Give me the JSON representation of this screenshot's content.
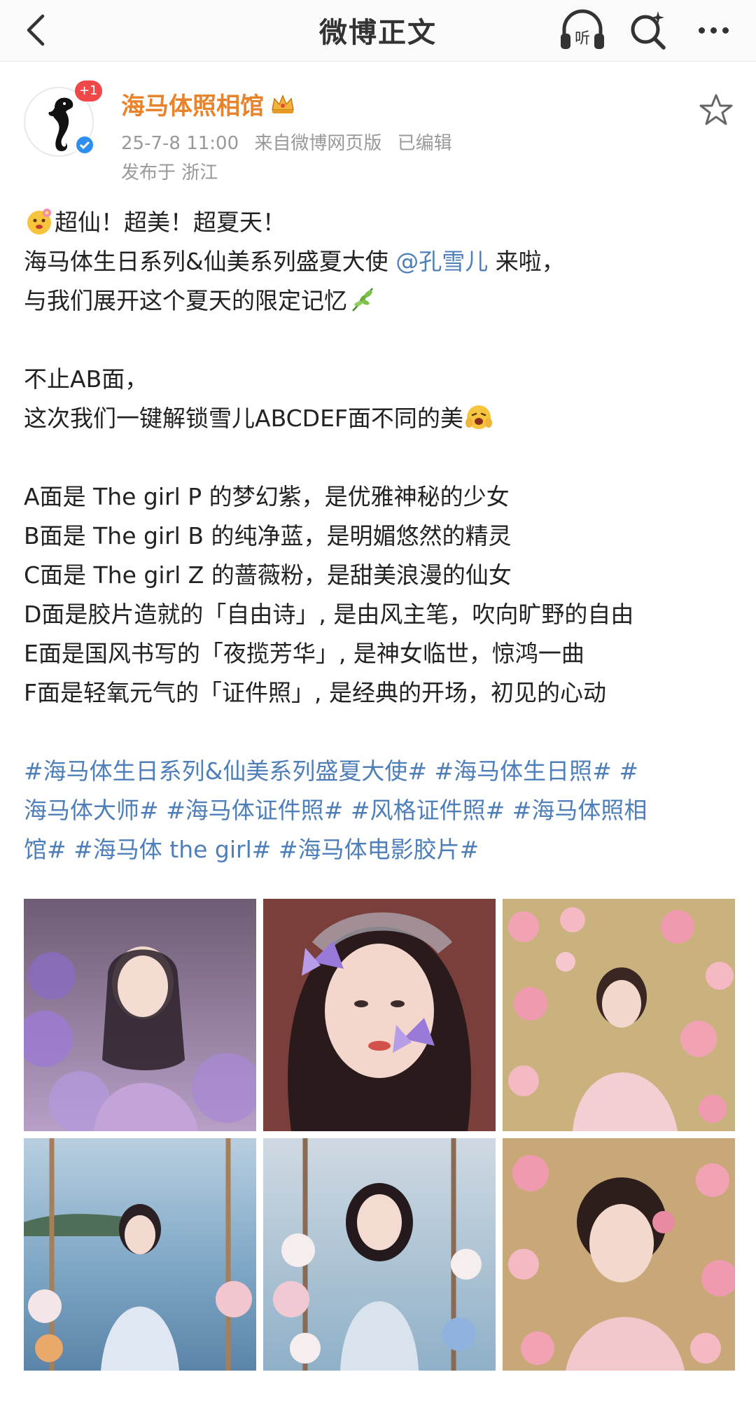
{
  "nav": {
    "title": "微博正文",
    "back_icon": "chevron-left-icon",
    "listen_label": "听",
    "search_icon": "search-sparkle-icon",
    "more_icon": "more-dots-icon"
  },
  "author": {
    "name": "海马体照相馆",
    "plus_badge": "+1",
    "crown_icon": "crown-icon",
    "verified_icon": "verified-badge-icon",
    "date": "25-7-8 11:00",
    "source": "来自微博网页版",
    "edited": "已编辑",
    "location": "发布于 浙江"
  },
  "post": {
    "line1": "超仙！超美！超夏天！",
    "line2_pre": "海马体生日系列&仙美系列盛夏大使 ",
    "line2_mention": "@孔雪儿",
    "line2_post": " 来啦，",
    "line3": "与我们展开这个夏天的限定记忆",
    "line4": "不止AB面，",
    "line5": "这次我们一键解锁雪儿ABCDEF面不同的美",
    "line6": "A面是 The girl P 的梦幻紫，是优雅神秘的少女",
    "line7": "B面是 The girl B 的纯净蓝，是明媚悠然的精灵",
    "line8": "C面是 The girl Z 的蔷薇粉，是甜美浪漫的仙女",
    "line9": "D面是胶片造就的「自由诗」, 是由风主笔，吹向旷野的自由",
    "line10": "E面是国风书写的「夜揽芳华」, 是神女临世，惊鸿一曲",
    "line11": "F面是轻氧元气的「证件照」, 是经典的开场，初见的心动",
    "hashtag_line1": "#海马体生日系列&仙美系列盛夏大使# #海马体生日照# #",
    "hashtag_line2": "海马体大师# #海马体证件照# #风格证件照#  #海马体照相",
    "hashtag_line3": "馆# #海马体 the girl# #海马体电影胶片#"
  },
  "photos": [
    {
      "label": "purple-flower-portrait"
    },
    {
      "label": "butterfly-closeup-portrait"
    },
    {
      "label": "pink-rose-garden-portrait"
    },
    {
      "label": "lake-swing-portrait"
    },
    {
      "label": "floral-swing-portrait"
    },
    {
      "label": "rose-closeup-portrait"
    }
  ],
  "colors": {
    "username": "#e8822b",
    "link": "#4f7fb8",
    "meta": "#999999",
    "badge": "#f04848",
    "verified": "#2d8ff0"
  }
}
